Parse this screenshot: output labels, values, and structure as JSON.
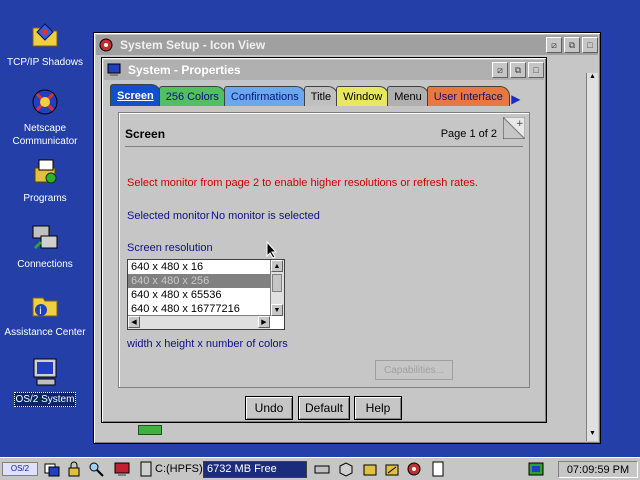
{
  "desktop": {
    "icons": [
      {
        "label": "TCP/IP Shadows"
      },
      {
        "label": "Netscape Communicator"
      },
      {
        "label": "Programs"
      },
      {
        "label": "Connections"
      },
      {
        "label": "Assistance Center"
      },
      {
        "label": "OS/2 System"
      }
    ]
  },
  "back_window": {
    "title": "System Setup - Icon View"
  },
  "properties_window": {
    "title": "System - Properties",
    "tabs": [
      {
        "label": "Screen",
        "color": "#1050c8"
      },
      {
        "label": "256 Colors",
        "color": "#50c060"
      },
      {
        "label": "Confirmations",
        "color": "#6aa8ee"
      },
      {
        "label": "Title",
        "color": "#c0c0c0"
      },
      {
        "label": "Window",
        "color": "#e8e860"
      },
      {
        "label": "Menu",
        "color": "#b0b0b0"
      },
      {
        "label": "User Interface",
        "color": "#e87840"
      }
    ],
    "page": {
      "title": "Screen",
      "page_indicator": "Page 1 of 2",
      "warning": "Select monitor from page 2 to enable higher resolutions or refresh rates.",
      "selected_monitor_label": "Selected monitor",
      "selected_monitor_value": "No monitor is selected",
      "resolution_label": "Screen resolution",
      "resolutions": [
        "640 x 480 x 16",
        "640 x 480 x 256",
        "640 x 480 x 65536",
        "640 x 480 x 16777216"
      ],
      "selected_resolution": "640 x 480 x 256",
      "list_hint": "width x height x number of colors",
      "capabilities_label": "Capabilities..."
    },
    "buttons": {
      "undo": "Undo",
      "default": "Default",
      "help": "Help"
    }
  },
  "taskbar": {
    "drive_label": "C:(HPFS)",
    "drive_free": "6732 MB Free",
    "clock": "07:09:59 PM"
  }
}
